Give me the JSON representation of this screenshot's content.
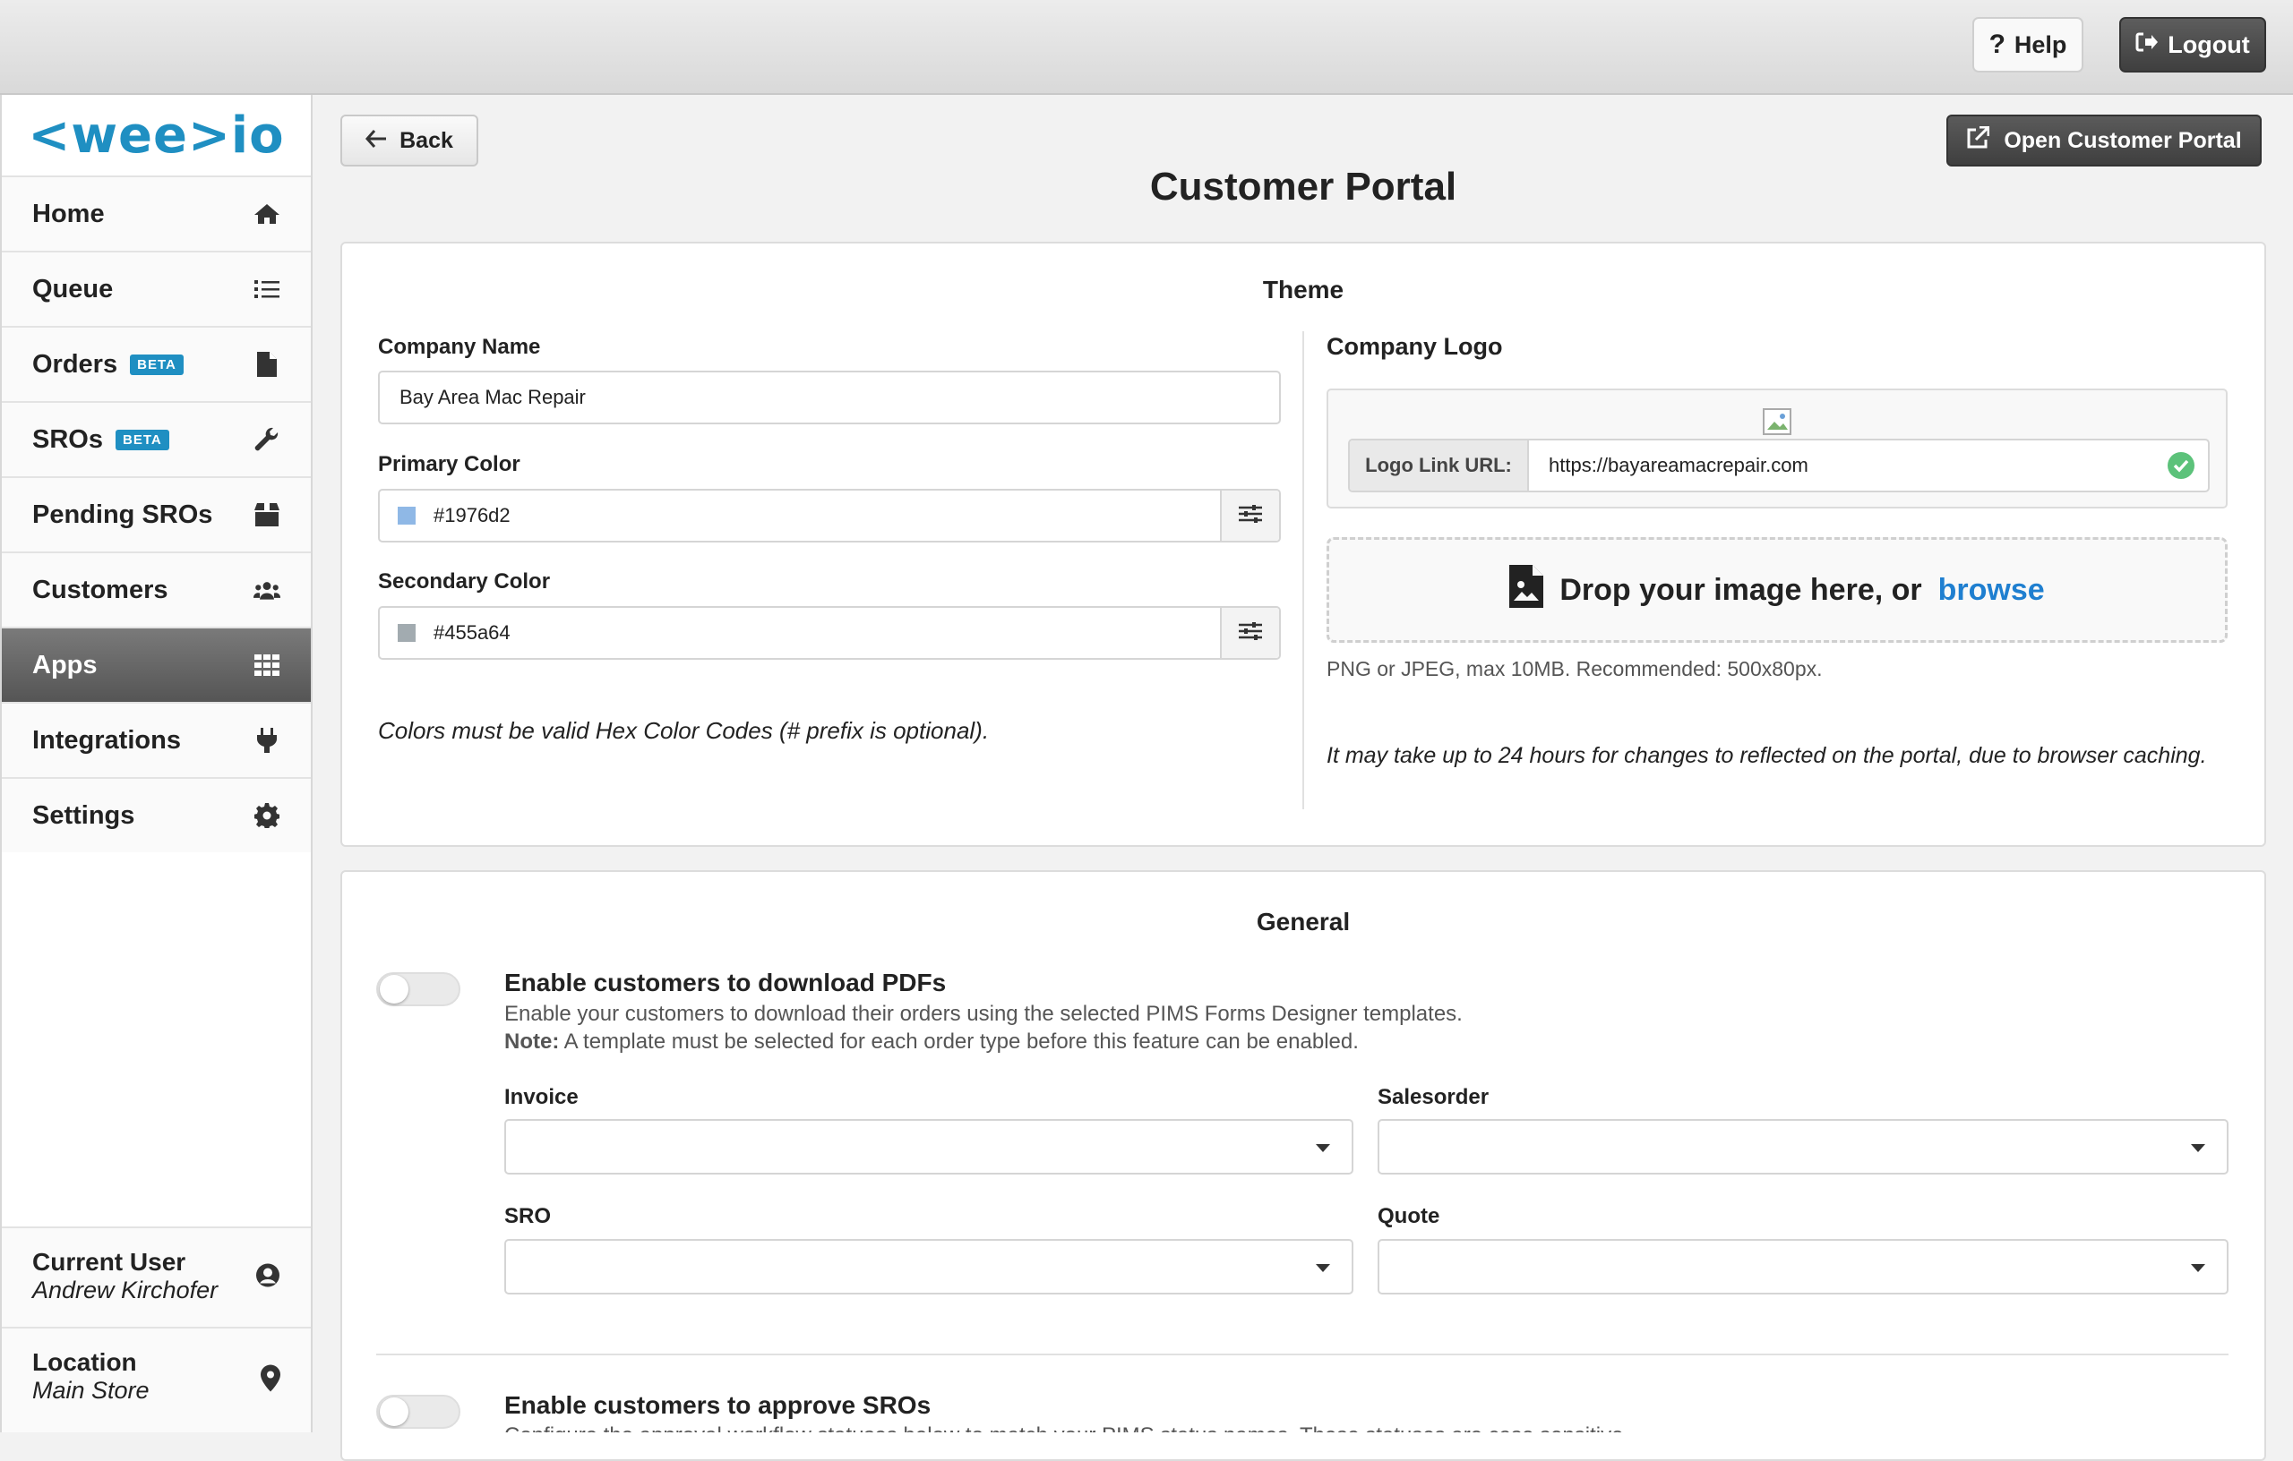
{
  "topbar": {
    "help_label": "Help",
    "logout_label": "Logout"
  },
  "sidebar": {
    "logo_text": "<wee>io",
    "items": [
      {
        "label": "Home",
        "icon": "home-icon"
      },
      {
        "label": "Queue",
        "icon": "list-icon"
      },
      {
        "label": "Orders",
        "icon": "file-icon",
        "badge": "BETA"
      },
      {
        "label": "SROs",
        "icon": "wrench-icon",
        "badge": "BETA"
      },
      {
        "label": "Pending SROs",
        "icon": "box-icon"
      },
      {
        "label": "Customers",
        "icon": "users-icon"
      },
      {
        "label": "Apps",
        "icon": "grid-icon",
        "active": true
      },
      {
        "label": "Integrations",
        "icon": "plug-icon"
      },
      {
        "label": "Settings",
        "icon": "gear-icon"
      }
    ],
    "current_user": {
      "title": "Current User",
      "name": "Andrew Kirchofer"
    },
    "location": {
      "title": "Location",
      "name": "Main Store"
    }
  },
  "header": {
    "back_label": "Back",
    "open_portal_label": "Open Customer Portal",
    "page_title": "Customer Portal"
  },
  "theme": {
    "title": "Theme",
    "company_name_label": "Company Name",
    "company_name_value": "Bay Area Mac Repair",
    "primary_color_label": "Primary Color",
    "primary_color_value": "#1976d2",
    "primary_swatch": "#8fb8e6",
    "secondary_color_label": "Secondary Color",
    "secondary_color_value": "#455a64",
    "secondary_swatch": "#a2abb0",
    "colors_note": "Colors must be valid Hex Color Codes (# prefix is optional).",
    "company_logo_label": "Company Logo",
    "logo_link_label": "Logo Link URL:",
    "logo_link_value": "https://bayareamacrepair.com",
    "drop_text": "Drop your image here, or",
    "browse_text": "browse",
    "file_hint": "PNG or JPEG, max 10MB. Recommended: 500x80px.",
    "cache_note": "It may take up to 24 hours for changes to reflected on the portal, due to browser caching."
  },
  "general": {
    "title": "General",
    "pdf_option": {
      "title": "Enable customers to download PDFs",
      "desc": "Enable your customers to download their orders using the selected PIMS Forms Designer templates.",
      "note_label": "Note:",
      "note_text": "A template must be selected for each order type before this feature can be enabled.",
      "enabled": false
    },
    "selects": [
      {
        "label": "Invoice",
        "value": ""
      },
      {
        "label": "Salesorder",
        "value": ""
      },
      {
        "label": "SRO",
        "value": ""
      },
      {
        "label": "Quote",
        "value": ""
      }
    ],
    "approve_option": {
      "title": "Enable customers to approve SROs",
      "desc": "Configure the approval workflow statuses below to match your PIMS status names. These statuses are case sensitive.",
      "enabled": false
    }
  },
  "colors": {
    "accent": "#1f8fc2",
    "link": "#1f7fd0",
    "dark_button": "#4a4a4a",
    "success": "#5cc27a"
  }
}
